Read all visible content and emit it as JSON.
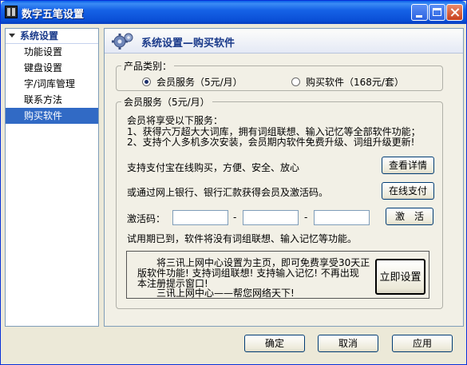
{
  "window": {
    "title": "数字五笔设置"
  },
  "sidebar": {
    "header": "系统设置",
    "items": [
      "功能设置",
      "键盘设置",
      "字/词库管理",
      "联系方法",
      "购买软件"
    ],
    "active_index": 4
  },
  "panel": {
    "title": "系统设置—购买软件",
    "category": {
      "legend": "产品类别：",
      "option1": "会员服务（5元/月）",
      "option2": "购买软件（168元/套）",
      "selected": "option1"
    },
    "member": {
      "legend": "会员服务（5元/月）",
      "intro": "会员将享受以下服务：",
      "benefit1": "1、获得六万超大大词库，拥有词组联想、输入记忆等全部软件功能；",
      "benefit2": "2、支持个人多机多次安装，会员期内软件免费升级、词组升级更新!",
      "alipay_text": "支持支付宝在线购买，方便、安全、放心",
      "details_button": "查看详情",
      "bank_text": "或通过网上银行、银行汇款获得会员及激活码。",
      "pay_button": "在线支付",
      "code_label": "激活码：",
      "code_sep1": "-",
      "code_sep2": "-",
      "code_part1": "",
      "code_part2": "",
      "code_part3": "",
      "activate_button": "激　活",
      "trial_text": "试用期已到，软件将没有词组联想、输入记忆等功能。"
    },
    "promo": {
      "line1": "将三讯上网中心设置为主页，即可免费享受30天正",
      "line2": "版软件功能! 支持词组联想! 支持输入记忆! 不再出现",
      "line3": "本注册提示窗口!",
      "line4": "三讯上网中心——帮您网络天下!",
      "button": "立即设置"
    }
  },
  "footer": {
    "ok": "确定",
    "cancel": "取消",
    "apply": "应用"
  }
}
